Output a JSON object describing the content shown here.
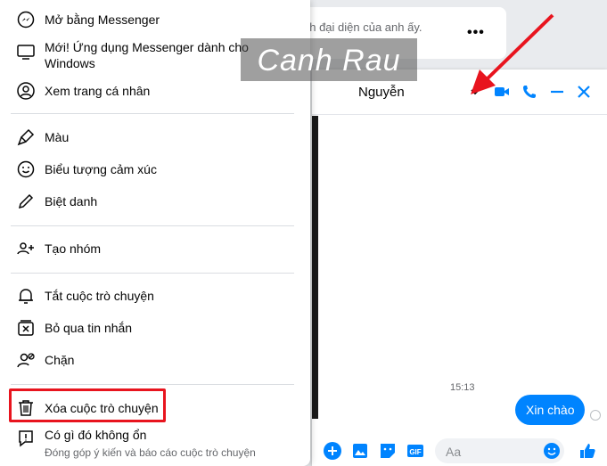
{
  "background": {
    "post_text": "nh đại diện của anh ấy.",
    "post_more": "•••"
  },
  "menu": {
    "items": [
      {
        "label": "Mở bằng Messenger",
        "icon": "messenger-icon"
      },
      {
        "label": "Mới! Ứng dụng Messenger dành cho",
        "label2": "Windows",
        "icon": "desktop-icon"
      },
      {
        "label": "Xem trang cá nhân",
        "icon": "profile-icon"
      },
      {
        "label": "Màu",
        "icon": "paint-brush-icon"
      },
      {
        "label": "Biểu tượng cảm xúc",
        "icon": "emoji-icon"
      },
      {
        "label": "Biệt danh",
        "icon": "pencil-icon"
      },
      {
        "label": "Tạo nhóm",
        "icon": "group-add-icon"
      },
      {
        "label": "Tắt cuộc trò chuyện",
        "icon": "bell-icon"
      },
      {
        "label": "Bỏ qua tin nhắn",
        "icon": "ignore-icon"
      },
      {
        "label": "Chặn",
        "icon": "block-user-icon"
      },
      {
        "label": "Xóa cuộc trò chuyện",
        "icon": "trash-icon"
      },
      {
        "label": "Có gì đó không ổn",
        "sub": "Đóng góp ý kiến và báo cáo cuộc trò chuyện",
        "icon": "report-icon"
      }
    ]
  },
  "chat": {
    "name": "Nguyễn",
    "time": "15:13",
    "message": "Xin chào",
    "input_placeholder": "Aa"
  },
  "watermark": {
    "text": "Canh Rau"
  },
  "colors": {
    "accent": "#0084ff",
    "highlight": "#e8141e",
    "arrow": "#e8141e"
  }
}
